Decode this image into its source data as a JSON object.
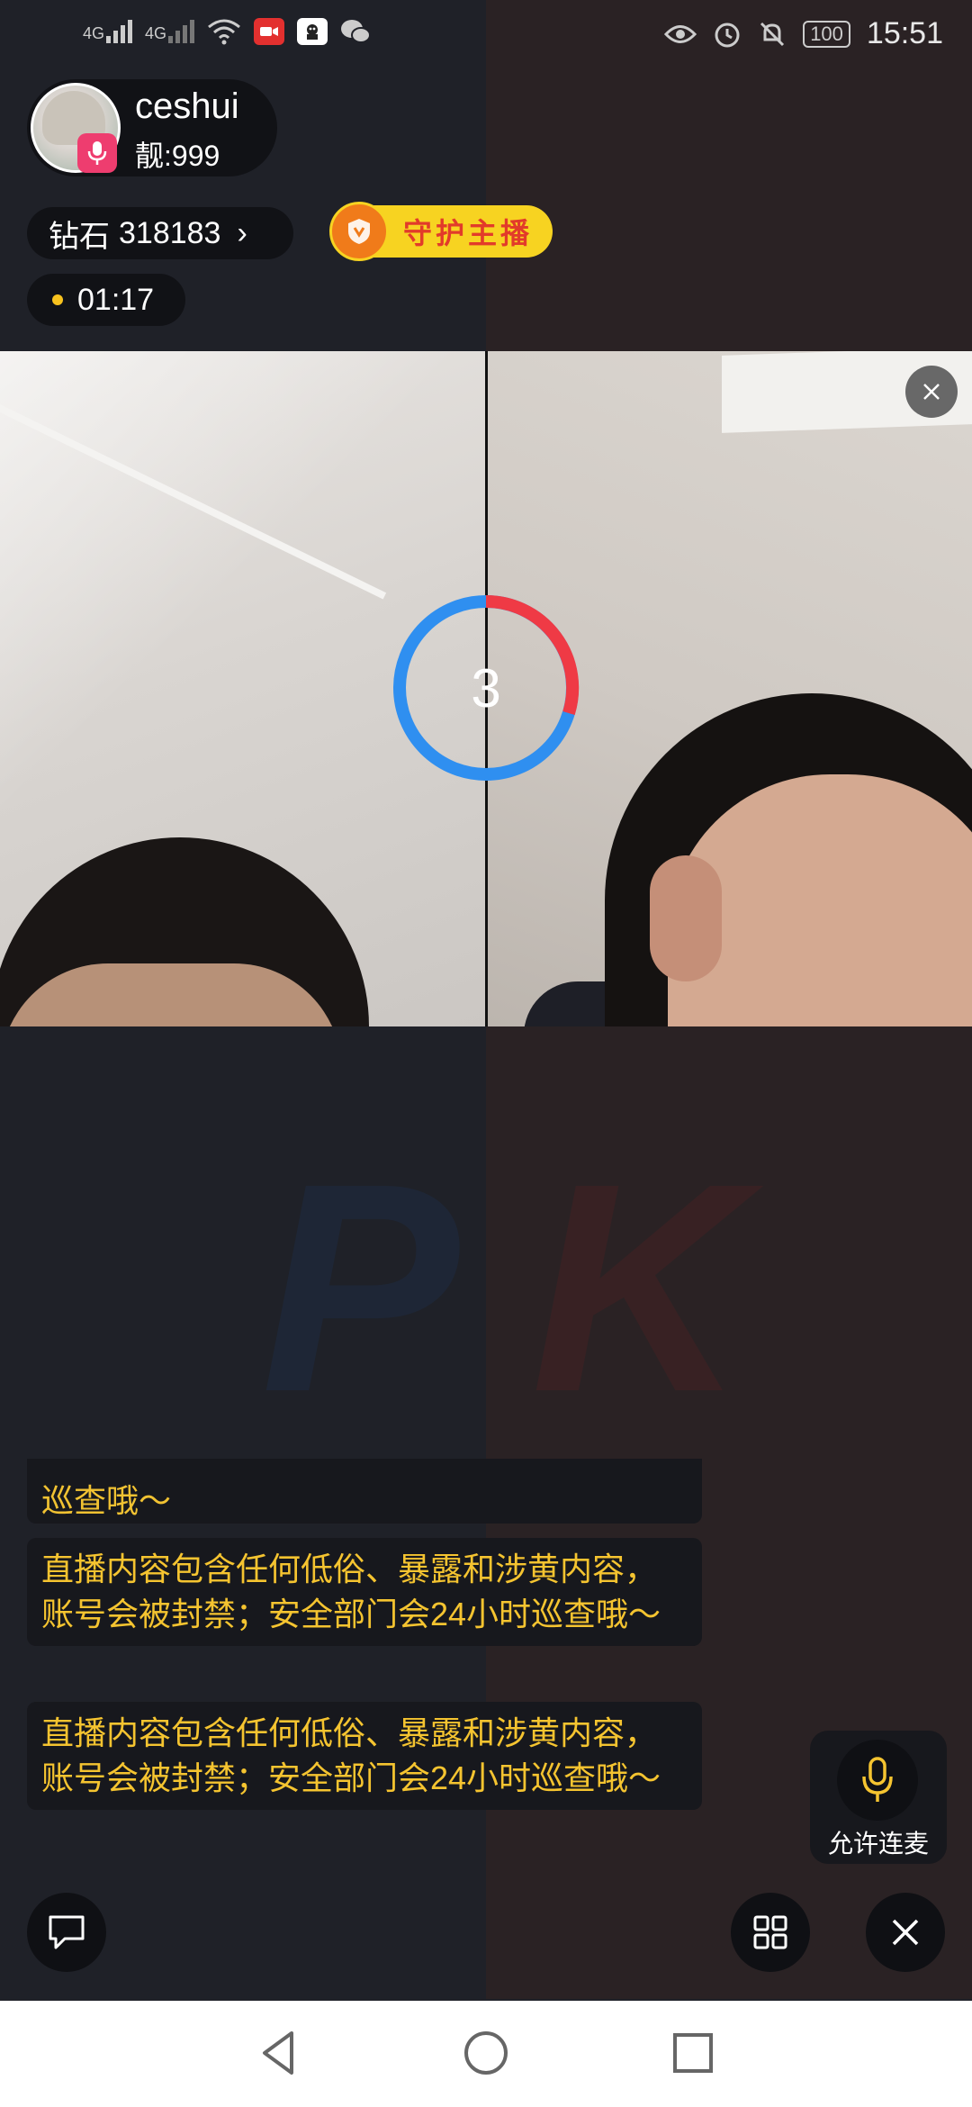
{
  "status_bar": {
    "network1": "4G",
    "network2": "4G",
    "battery": "100",
    "time": "15:51"
  },
  "host": {
    "name": "ceshui",
    "score": "靓:999"
  },
  "diamonds": {
    "label": "钻石",
    "value": "318183"
  },
  "guard_button": "守护主播",
  "timer": "01:17",
  "countdown": "3",
  "pk": {
    "p": "P",
    "k": "K"
  },
  "chat": {
    "partial_last_line": "巡查哦～",
    "messages": [
      "直播内容包含任何低俗、暴露和涉黄内容，账号会被封禁；安全部门会24小时巡查哦～",
      "直播内容包含任何低俗、暴露和涉黄内容，账号会被封禁；安全部门会24小时巡查哦～"
    ]
  },
  "mic_allow_label": "允许连麦",
  "colors": {
    "accent_yellow": "#f5c430",
    "pk_blue": "#2f8ff0",
    "pk_red": "#ef3a45",
    "host_mic_pink": "#ee3d6f"
  }
}
